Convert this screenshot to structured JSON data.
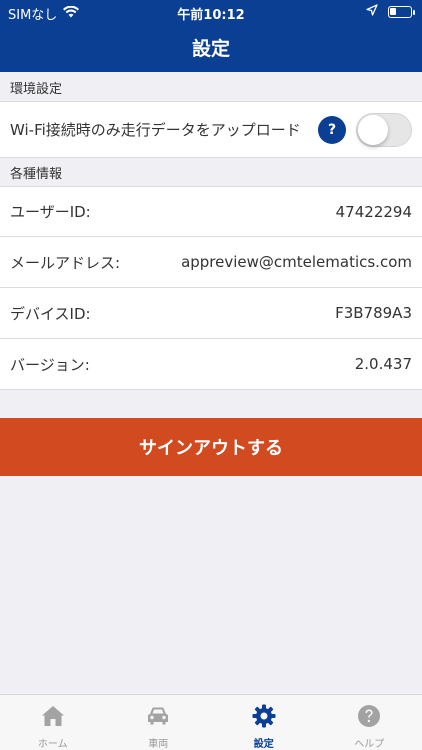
{
  "status_bar": {
    "carrier": "SIMなし",
    "time": "午前10:12"
  },
  "header": {
    "title": "設定"
  },
  "sections": {
    "environment": {
      "title": "環境設定",
      "wifi_upload_label": "Wi-Fi接続時のみ走行データをアップロード",
      "help_label": "?",
      "toggle_on": false
    },
    "info": {
      "title": "各種情報",
      "rows": [
        {
          "label": "ユーザーID:",
          "value": "47422294"
        },
        {
          "label": "メールアドレス:",
          "value": "appreview@cmtelematics.com"
        },
        {
          "label": "デバイスID:",
          "value": "F3B789A3"
        },
        {
          "label": "バージョン:",
          "value": "2.0.437"
        }
      ]
    }
  },
  "signout_label": "サインアウトする",
  "tabbar": {
    "items": [
      {
        "label": "ホーム",
        "icon": "home-icon",
        "active": false
      },
      {
        "label": "車両",
        "icon": "car-icon",
        "active": false
      },
      {
        "label": "設定",
        "icon": "gear-icon",
        "active": true
      },
      {
        "label": "ヘルプ",
        "icon": "help-icon",
        "active": false
      }
    ]
  },
  "colors": {
    "header_bg": "#0a3f94",
    "signout_bg": "#d14a20",
    "active_tab": "#0a3f94",
    "inactive_tab": "#9a9a9a"
  }
}
